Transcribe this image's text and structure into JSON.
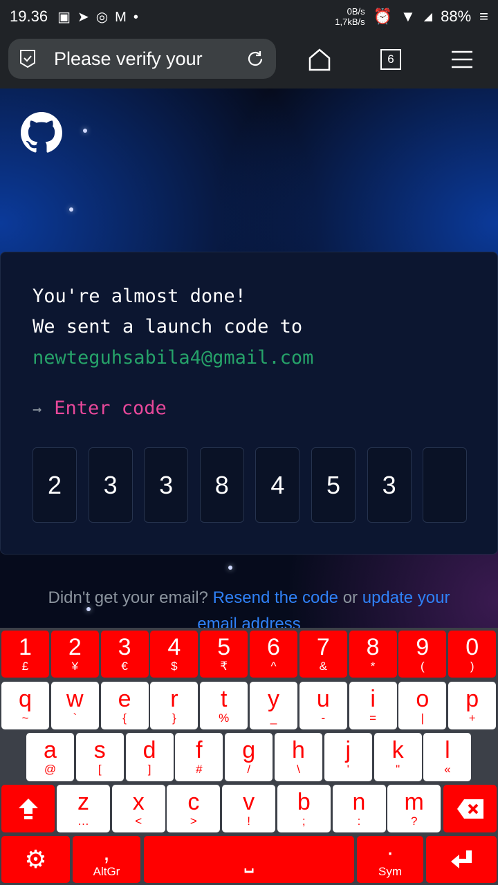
{
  "status": {
    "time": "19.36",
    "net_up": "0B/s",
    "net_down": "1,7kB/s",
    "battery": "88%"
  },
  "browser": {
    "title": "Please verify your",
    "tab_count": "6"
  },
  "page": {
    "line1": "You're almost done!",
    "line2": "We sent a launch code to",
    "email": "newteguhsabila4@gmail.com",
    "prompt_arrow": "→",
    "prompt": "Enter code",
    "code": [
      "2",
      "3",
      "3",
      "8",
      "4",
      "5",
      "3",
      ""
    ],
    "footer_text1": "Didn't get your email?",
    "resend": "Resend the code",
    "footer_or": "or",
    "update": "update your email address",
    "colors": {
      "email": "#26a269",
      "prompt": "#e8489a"
    }
  },
  "keyboard": {
    "rows": [
      [
        [
          "1",
          "£"
        ],
        [
          "2",
          "¥"
        ],
        [
          "3",
          "€"
        ],
        [
          "4",
          "$"
        ],
        [
          "5",
          "₹"
        ],
        [
          "6",
          "^"
        ],
        [
          "7",
          "&"
        ],
        [
          "8",
          "*"
        ],
        [
          "9",
          "("
        ],
        [
          "0",
          ")"
        ]
      ],
      [
        [
          "q",
          "~"
        ],
        [
          "w",
          "`"
        ],
        [
          "e",
          "{"
        ],
        [
          "r",
          "}"
        ],
        [
          "t",
          "%"
        ],
        [
          "y",
          "_"
        ],
        [
          "u",
          "-"
        ],
        [
          "i",
          "="
        ],
        [
          "o",
          "|"
        ],
        [
          "p",
          "+"
        ]
      ],
      [
        [
          "a",
          "@"
        ],
        [
          "s",
          "["
        ],
        [
          "d",
          "]"
        ],
        [
          "f",
          "#"
        ],
        [
          "g",
          "/"
        ],
        [
          "h",
          "\\"
        ],
        [
          "j",
          "'"
        ],
        [
          "k",
          "\""
        ],
        [
          "l",
          "«"
        ]
      ],
      [
        [
          "z",
          "…"
        ],
        [
          "x",
          "<"
        ],
        [
          "c",
          ">"
        ],
        [
          "v",
          "!"
        ],
        [
          "b",
          ";"
        ],
        [
          "n",
          ":"
        ],
        [
          "m",
          "?"
        ]
      ]
    ],
    "altgr": {
      "main": ",",
      "sub": "AltGr"
    },
    "sym": {
      "main": "·",
      "sub": "Sym"
    },
    "space": "⎵"
  }
}
